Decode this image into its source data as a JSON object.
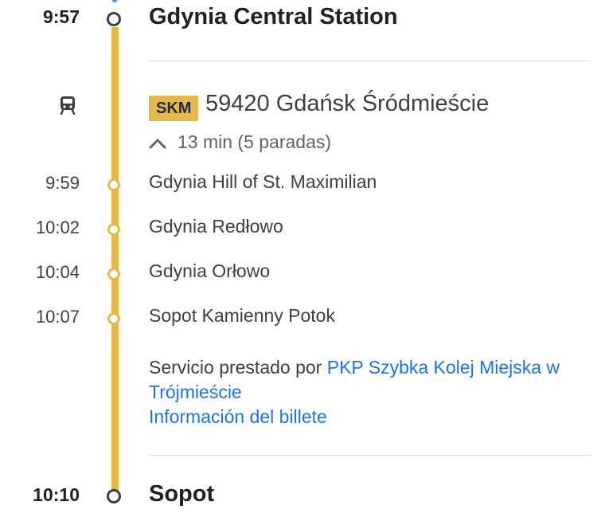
{
  "departure": {
    "time": "9:57",
    "station": "Gdynia Central Station"
  },
  "line": {
    "badge": "SKM",
    "title": "59420 Gdańsk Śródmieście",
    "duration_toggle": "13 min (5 paradas)",
    "color": "#E5B847"
  },
  "stops": [
    {
      "time": "9:59",
      "name": "Gdynia Hill of St. Maximilian"
    },
    {
      "time": "10:02",
      "name": "Gdynia Redłowo"
    },
    {
      "time": "10:04",
      "name": "Gdynia Orłowo"
    },
    {
      "time": "10:07",
      "name": "Sopot Kamienny Potok"
    }
  ],
  "service": {
    "prefix": "Servicio prestado por",
    "operator_link": "PKP Szybka Kolej Miejska w Trójmieście",
    "ticket_link": "Información del billete"
  },
  "arrival": {
    "time": "10:10",
    "station": "Sopot"
  },
  "icons": {
    "vehicle": "train-icon",
    "toggle": "chevron-up-icon"
  }
}
